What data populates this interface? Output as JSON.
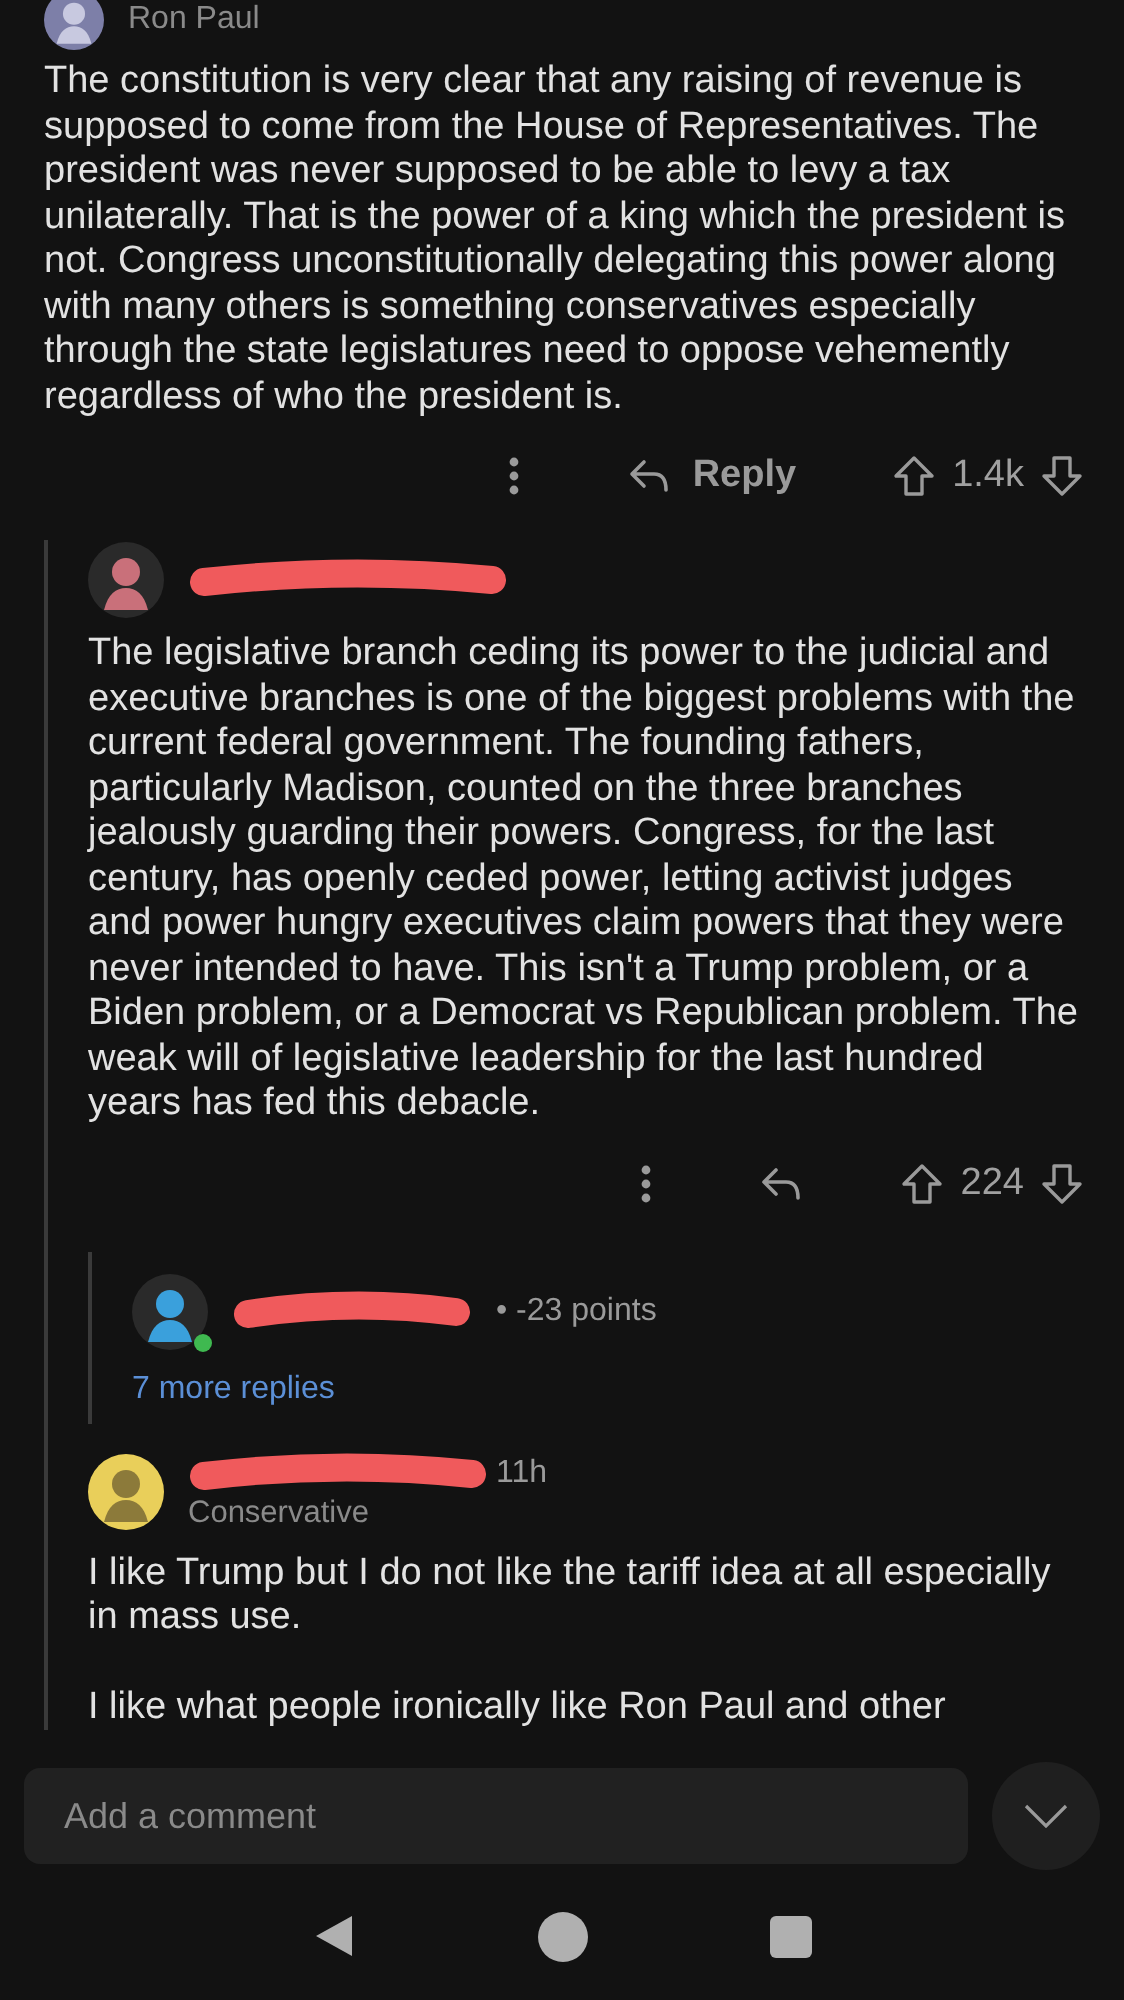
{
  "top_comment": {
    "author": "Ron Paul",
    "body": "The constitution is very clear that any raising of revenue is supposed to come from the House of Representatives. The president was never supposed to be able to levy a tax unilaterally. That is the power of a king which the president is not. Congress unconstitutionally delegating this power along with many others is something conservatives especially through the state legislatures need to oppose vehemently regardless of who the president is.",
    "reply_label": "Reply",
    "score": "1.4k"
  },
  "reply": {
    "body": "The legislative branch ceding its power to the judicial and executive branches is one of the biggest problems with the current federal government.  The founding fathers, particularly Madison, counted on the three branches jealously guarding their powers.  Congress, for the last century, has openly ceded power, letting activist judges and power hungry executives claim powers that they were never intended to have.  This isn't a Trump problem, or a Biden problem, or a Democrat vs Republican problem. The weak will of legislative leadership for the last hundred years has fed this debacle.",
    "score": "224",
    "nested": {
      "meta": "• -23 points",
      "online": true,
      "more_replies": "7 more replies"
    }
  },
  "second_reply": {
    "time": "11h",
    "flair": "Conservative",
    "paragraphs": [
      "I like Trump but I do not like the tariff idea at all especially in mass use.",
      "I like what people ironically like Ron Paul and other"
    ]
  },
  "composer": {
    "placeholder": "Add a comment"
  }
}
